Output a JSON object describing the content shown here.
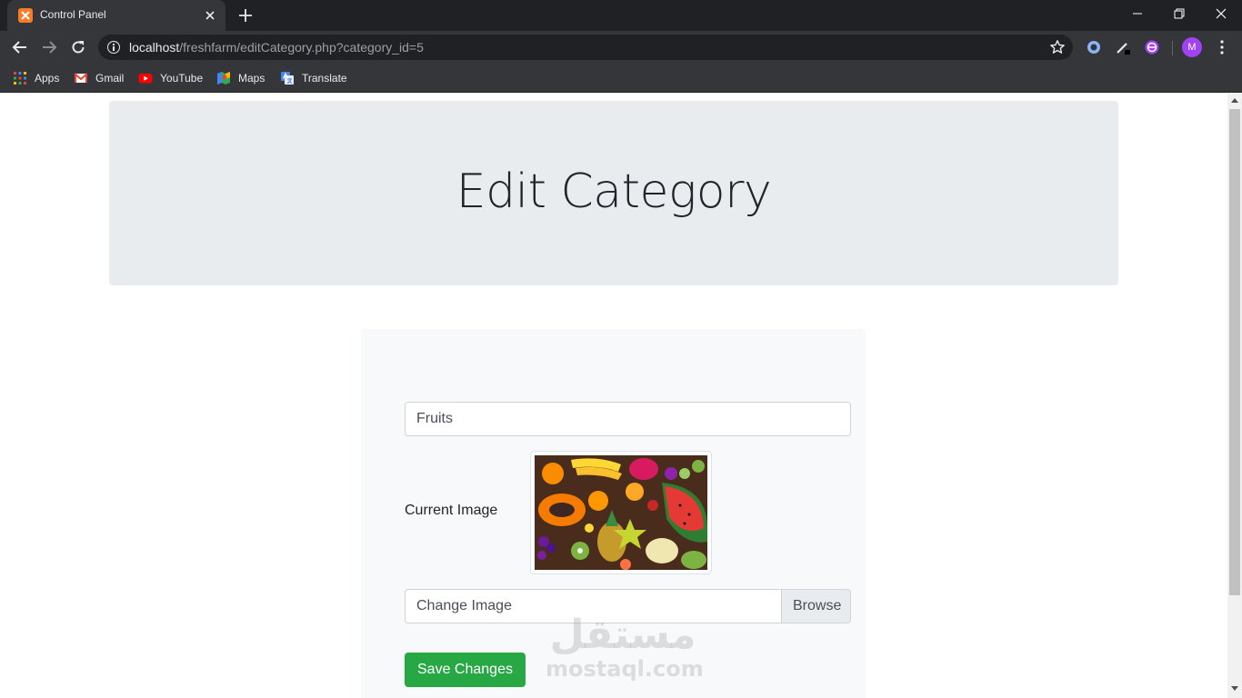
{
  "browser": {
    "tab_title": "Control Panel",
    "url_host": "localhost",
    "url_path": "/freshfarm/editCategory.php?category_id=5",
    "profile_initial": "M",
    "bookmarks": [
      {
        "label": "Apps",
        "icon": "apps-grid-icon"
      },
      {
        "label": "Gmail",
        "icon": "gmail-icon"
      },
      {
        "label": "YouTube",
        "icon": "youtube-icon"
      },
      {
        "label": "Maps",
        "icon": "maps-icon"
      },
      {
        "label": "Translate",
        "icon": "translate-icon"
      }
    ]
  },
  "page": {
    "heading": "Edit Category",
    "form": {
      "category_name_value": "Fruits",
      "current_image_label": "Current Image",
      "current_image_alt": "Assorted fruits",
      "file_input_label": "Change Image",
      "browse_label": "Browse",
      "save_label": "Save Changes"
    }
  },
  "watermark": {
    "arabic": "مستقل",
    "latin": "mostaql.com"
  },
  "colors": {
    "chrome_dark": "#202124",
    "chrome_toolbar": "#35363a",
    "jumbotron_bg": "#e9ecef",
    "card_bg": "#f8f9fa",
    "success_green": "#28a745"
  }
}
